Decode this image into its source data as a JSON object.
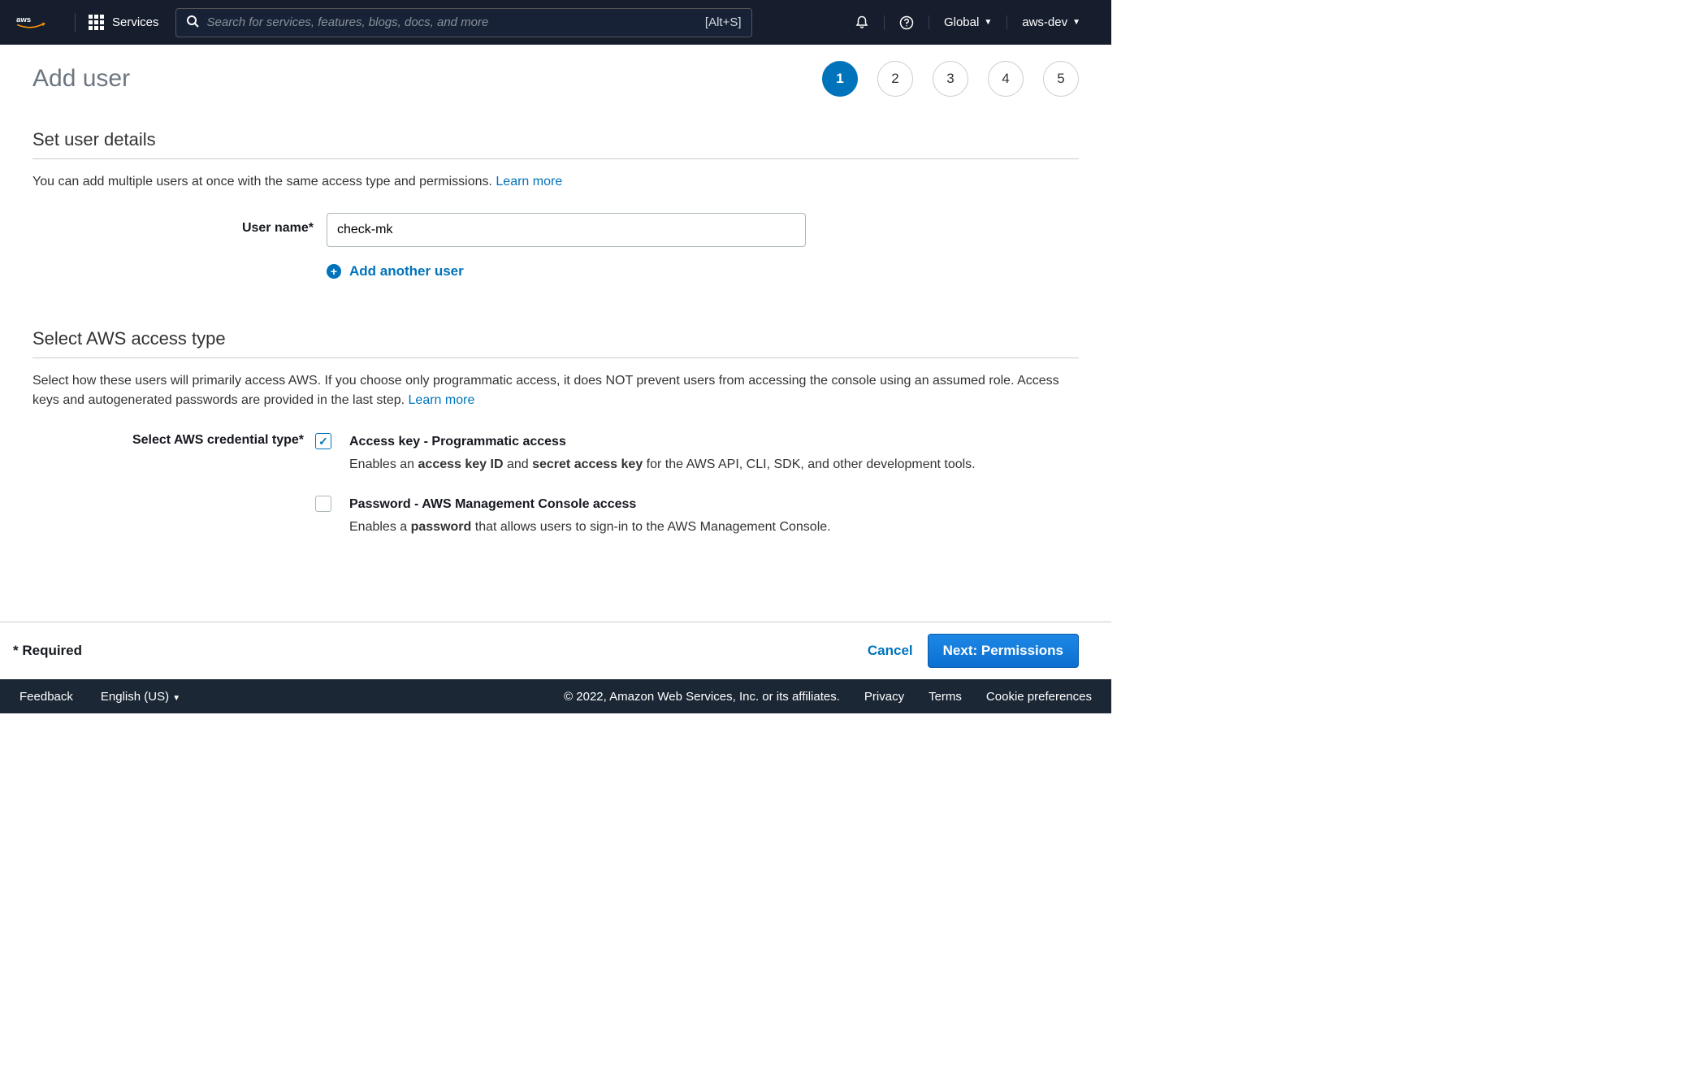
{
  "topnav": {
    "services": "Services",
    "search_placeholder": "Search for services, features, blogs, docs, and more",
    "search_shortcut": "[Alt+S]",
    "region": "Global",
    "account": "aws-dev"
  },
  "page": {
    "title": "Add user",
    "steps": [
      "1",
      "2",
      "3",
      "4",
      "5"
    ],
    "active_step": 0
  },
  "section1": {
    "title": "Set user details",
    "desc": "You can add multiple users at once with the same access type and permissions. ",
    "learn_more": "Learn more",
    "username_label": "User name*",
    "username_value": "check-mk",
    "add_another": "Add another user"
  },
  "section2": {
    "title": "Select AWS access type",
    "desc": "Select how these users will primarily access AWS. If you choose only programmatic access, it does NOT prevent users from accessing the console using an assumed role. Access keys and autogenerated passwords are provided in the last step. ",
    "learn_more": "Learn more",
    "cred_label": "Select AWS credential type*",
    "options": [
      {
        "title": "Access key - Programmatic access",
        "desc_pre": "Enables an ",
        "desc_b1": "access key ID",
        "desc_mid": " and ",
        "desc_b2": "secret access key",
        "desc_post": " for the AWS API, CLI, SDK, and other development tools.",
        "checked": true
      },
      {
        "title": "Password - AWS Management Console access",
        "desc_pre": "Enables a ",
        "desc_b1": "password",
        "desc_mid": "",
        "desc_b2": "",
        "desc_post": " that allows users to sign-in to the AWS Management Console.",
        "checked": false
      }
    ]
  },
  "footer": {
    "required": "* Required",
    "cancel": "Cancel",
    "next": "Next: Permissions"
  },
  "bottombar": {
    "feedback": "Feedback",
    "language": "English (US)",
    "copyright": "© 2022, Amazon Web Services, Inc. or its affiliates.",
    "privacy": "Privacy",
    "terms": "Terms",
    "cookies": "Cookie preferences"
  }
}
